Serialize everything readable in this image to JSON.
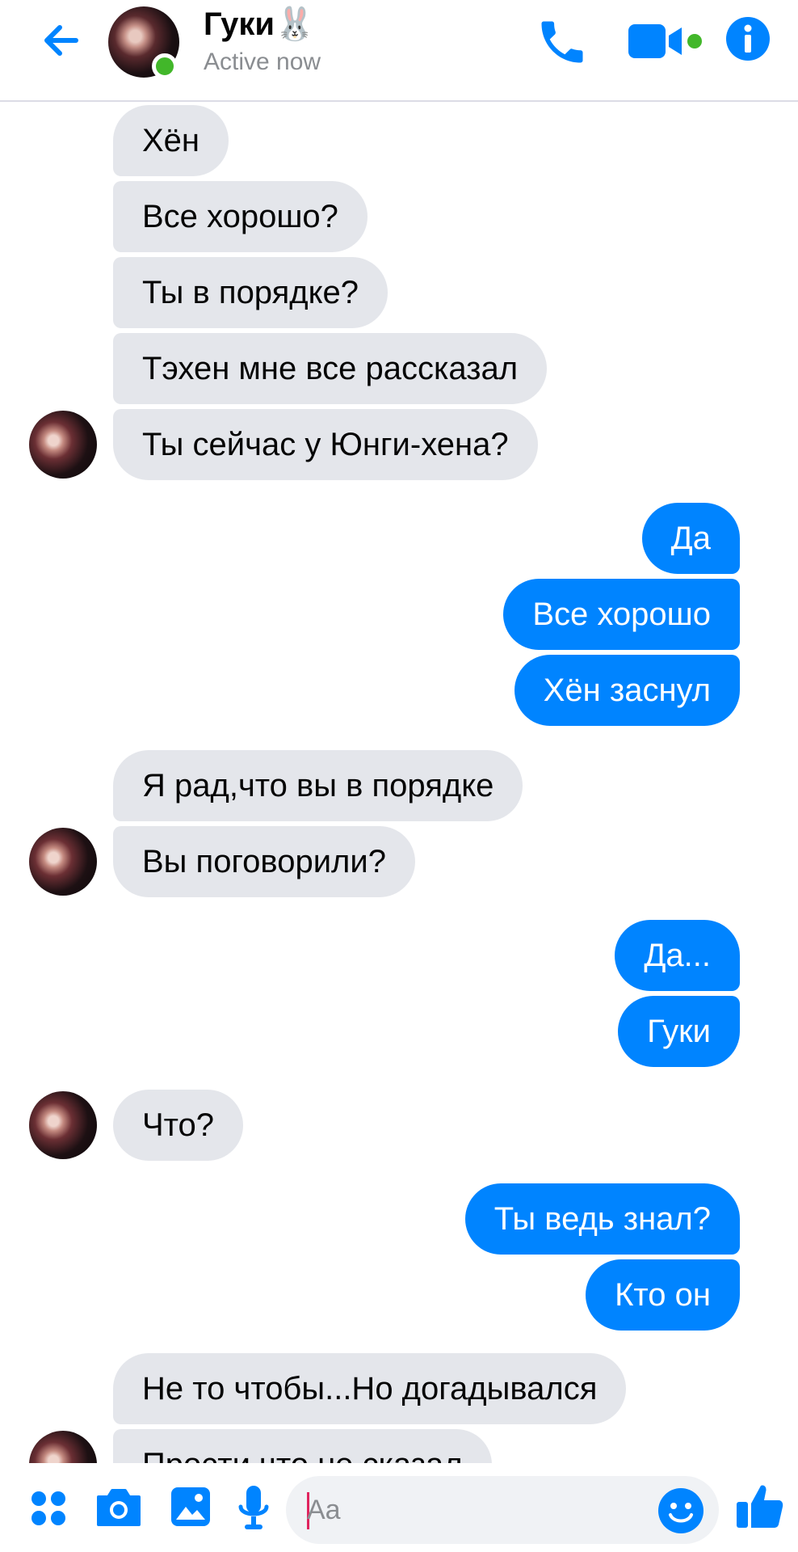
{
  "header": {
    "contact_name": "Гуки🐰",
    "status": "Active now"
  },
  "messages": [
    {
      "side": "in",
      "text": "Хён"
    },
    {
      "side": "in",
      "text": "Все хорошо?"
    },
    {
      "side": "in",
      "text": "Ты в порядке?"
    },
    {
      "side": "in",
      "text": "Тэхен мне все рассказал"
    },
    {
      "side": "in",
      "text": "Ты сейчас у Юнги-хена?"
    },
    {
      "side": "out",
      "text": "Да"
    },
    {
      "side": "out",
      "text": "Все хорошо"
    },
    {
      "side": "out",
      "text": "Хён заснул"
    },
    {
      "side": "in",
      "text": "Я рад,что вы в порядке"
    },
    {
      "side": "in",
      "text": "Вы поговорили?"
    },
    {
      "side": "out",
      "text": "Да..."
    },
    {
      "side": "out",
      "text": "Гуки"
    },
    {
      "side": "in",
      "text": "Что?"
    },
    {
      "side": "out",
      "text": "Ты ведь знал?"
    },
    {
      "side": "out",
      "text": "Кто он"
    },
    {
      "side": "in",
      "text": "Не то чтобы...Но догадывался"
    },
    {
      "side": "in",
      "text": "Прости что не сказал"
    }
  ],
  "composer": {
    "placeholder": "Aa"
  },
  "icons": {
    "back": "arrow-left-icon",
    "call": "phone-icon",
    "video": "video-camera-icon",
    "info": "info-icon",
    "more": "four-dots-icon",
    "camera": "camera-icon",
    "gallery": "image-icon",
    "voice": "microphone-icon",
    "emoji": "smiley-icon",
    "like": "thumbs-up-icon"
  },
  "colors": {
    "accent": "#0084ff",
    "incoming_bubble": "#e4e6eb",
    "online": "#42b72a"
  }
}
